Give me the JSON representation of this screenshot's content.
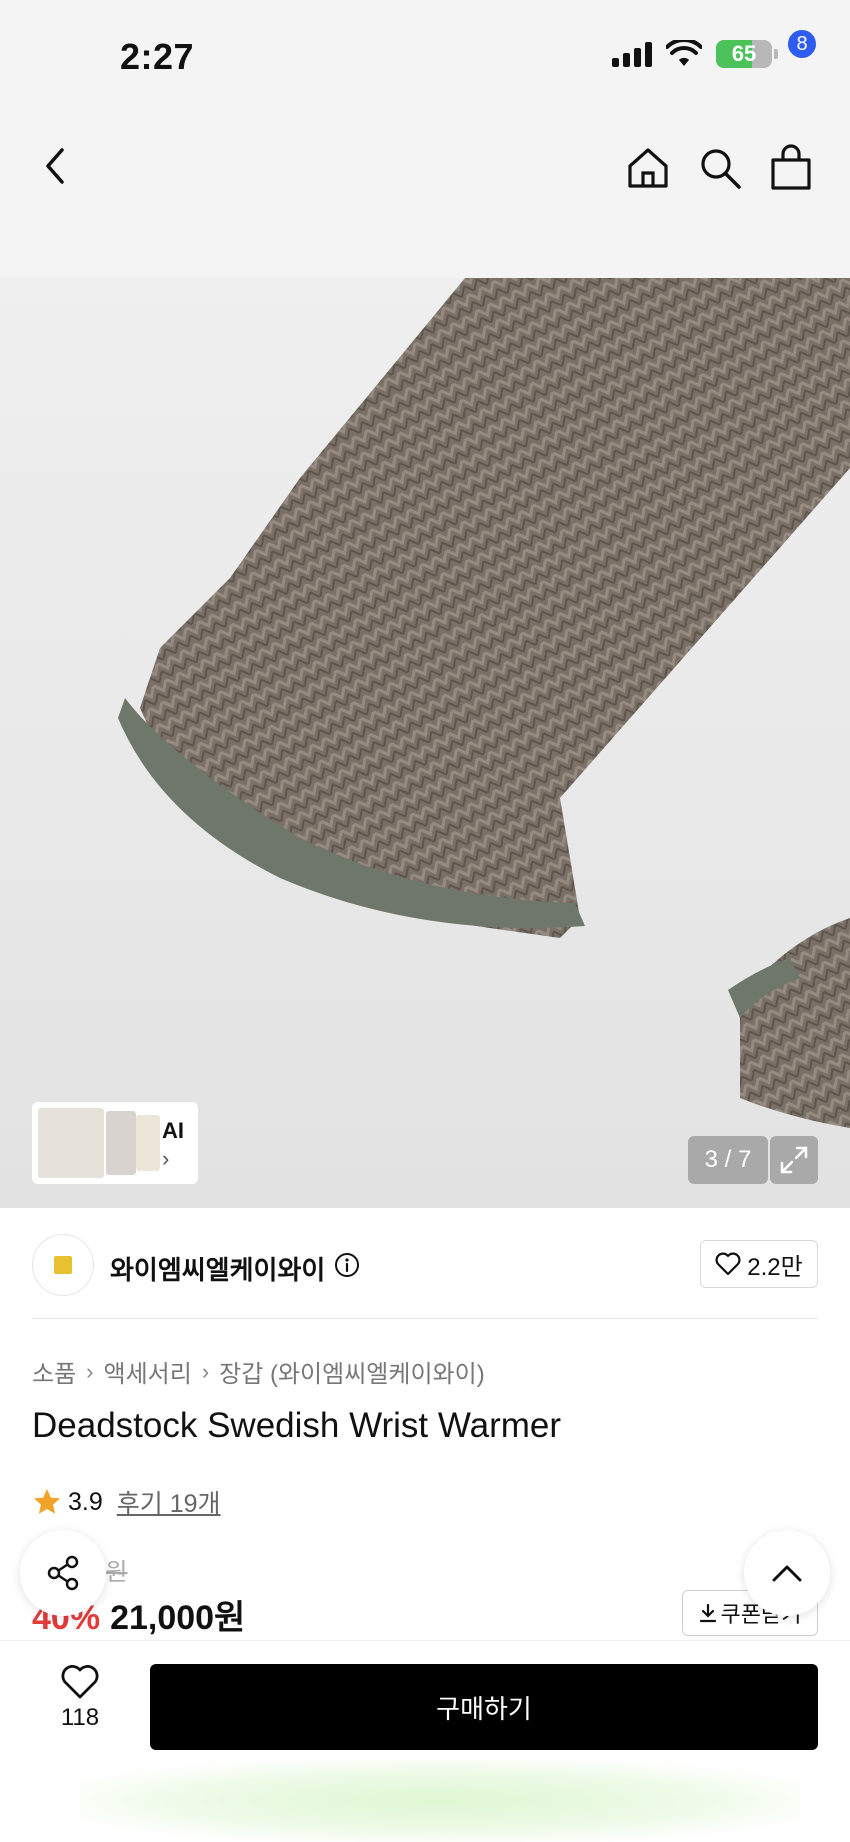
{
  "status_bar": {
    "time": "2:27",
    "battery": "65"
  },
  "nav": {
    "cart_count": "8"
  },
  "gallery": {
    "ai_label": "AI",
    "ai_chevron": "›",
    "pager": "3 / 7"
  },
  "seller": {
    "name": "와이엠씨엘케이와이",
    "likes": "2.2만"
  },
  "breadcrumb": [
    "소품",
    "액세서리",
    "장갑 (와이엠씨엘케이와이)"
  ],
  "breadcrumb_sep": "›",
  "product": {
    "title": "Deadstock Swedish Wrist Warmer",
    "rating": "3.9",
    "reviews": "후기 19개",
    "original_price": "35,000원",
    "discount": "40%",
    "price": "21,000원"
  },
  "coupon_label": "쿠폰받기",
  "bottom": {
    "wish_count": "118",
    "buy_label": "구매하기"
  },
  "colors": {
    "accent_blue": "#2f5cf0",
    "discount_red": "#e23b3b",
    "star": "#f2a32a",
    "buy_bg": "#000000"
  },
  "icons": [
    "back-icon",
    "home-icon",
    "search-icon",
    "cart-icon",
    "expand-icon",
    "info-icon",
    "heart-icon",
    "star-icon",
    "share-icon",
    "arrow-up-icon",
    "download-icon"
  ]
}
